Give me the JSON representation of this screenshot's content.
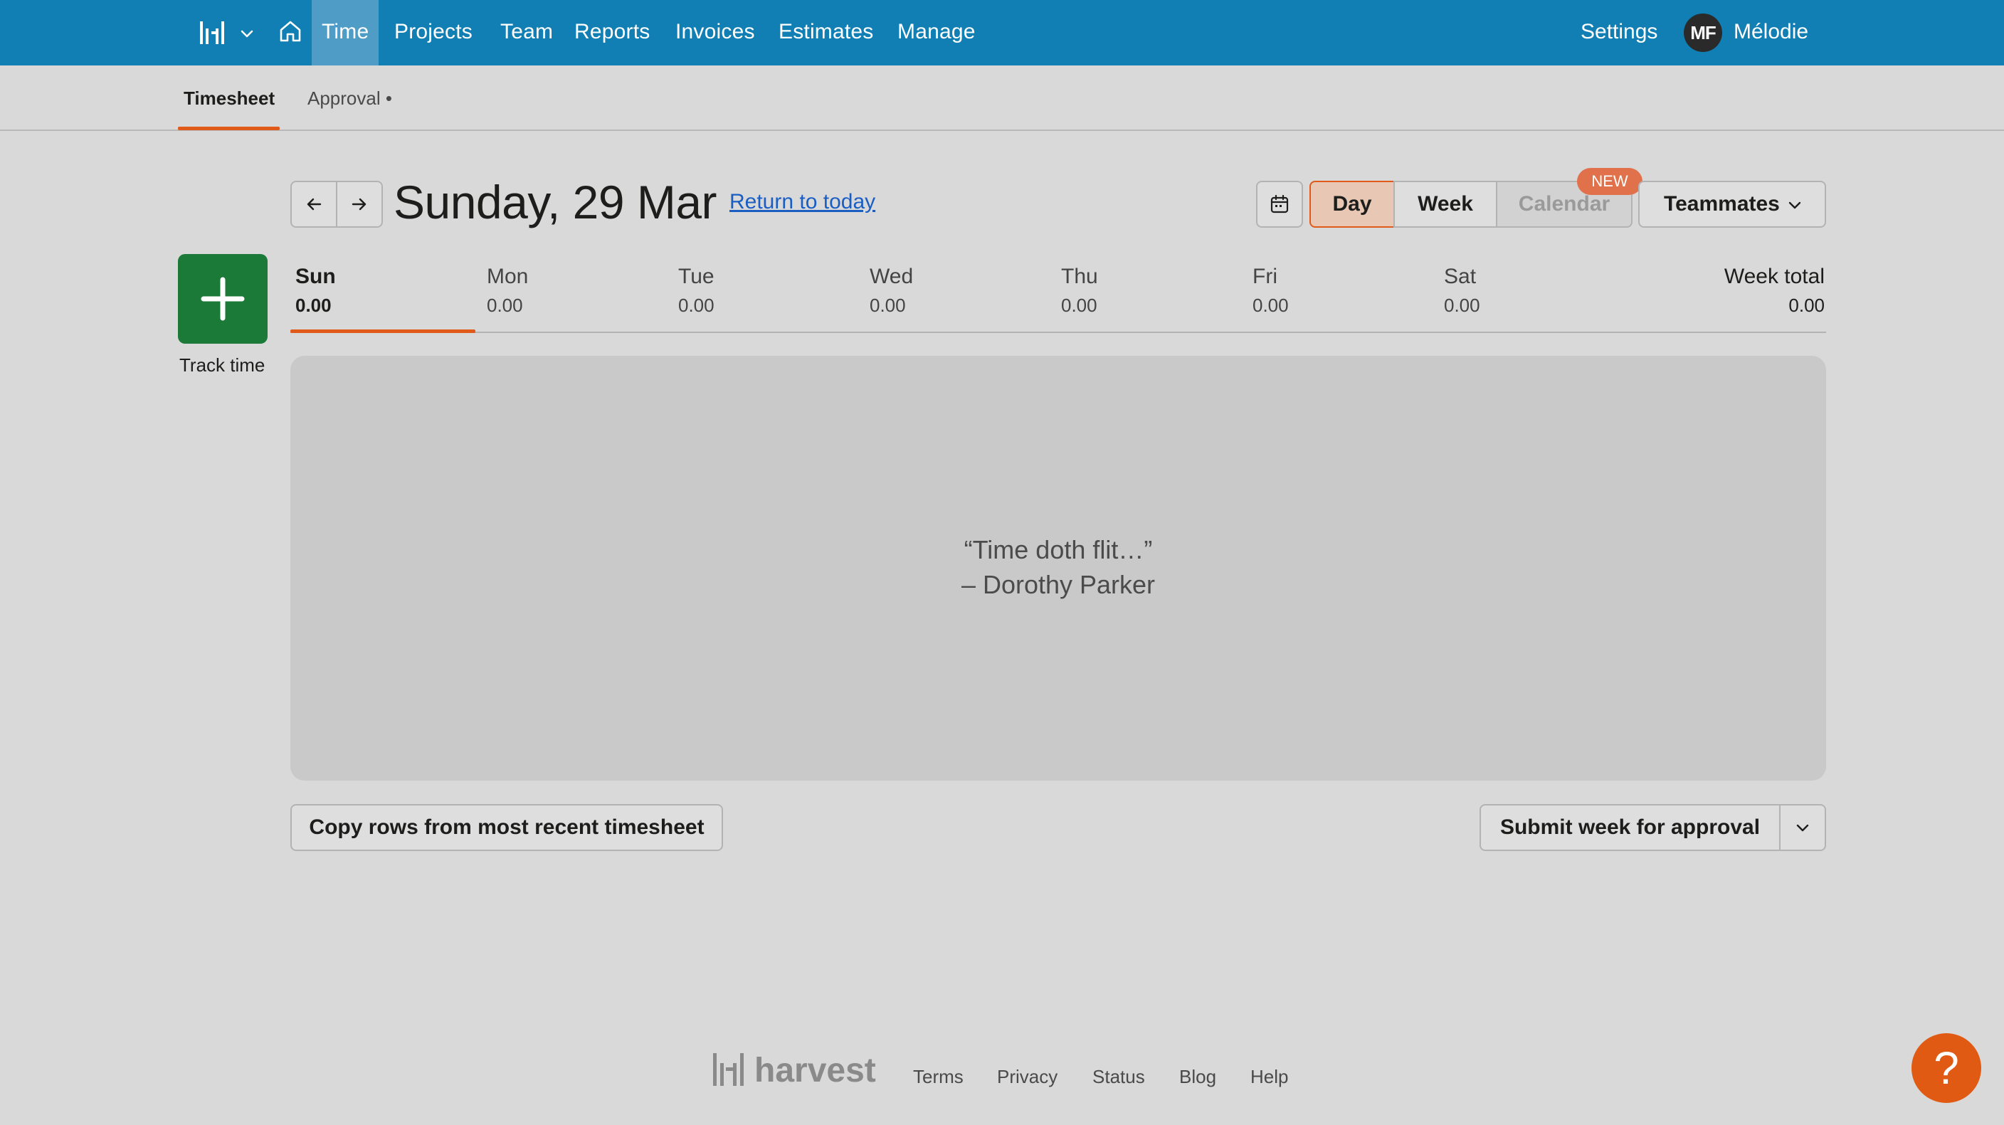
{
  "nav": {
    "logo_icon": "harvest-logo-icon",
    "items": [
      {
        "label": "Time",
        "active": true
      },
      {
        "label": "Projects"
      },
      {
        "label": "Team"
      },
      {
        "label": "Reports"
      },
      {
        "label": "Invoices"
      },
      {
        "label": "Estimates"
      },
      {
        "label": "Manage"
      }
    ],
    "settings_label": "Settings",
    "avatar_initials": "MF",
    "user_name": "Mélodie"
  },
  "subnav": {
    "tabs": [
      {
        "label": "Timesheet",
        "active": true
      },
      {
        "label": "Approval •"
      }
    ]
  },
  "header": {
    "date_title": "Sunday, 29 Mar",
    "return_link": "Return to today",
    "views": {
      "day": "Day",
      "week": "Week",
      "calendar": "Calendar"
    },
    "new_badge": "NEW",
    "teammates_label": "Teammates"
  },
  "track": {
    "label": "Track time"
  },
  "days": [
    {
      "name": "Sun",
      "value": "0.00",
      "active": true
    },
    {
      "name": "Mon",
      "value": "0.00"
    },
    {
      "name": "Tue",
      "value": "0.00"
    },
    {
      "name": "Wed",
      "value": "0.00"
    },
    {
      "name": "Thu",
      "value": "0.00"
    },
    {
      "name": "Fri",
      "value": "0.00"
    },
    {
      "name": "Sat",
      "value": "0.00"
    }
  ],
  "week_total": {
    "label": "Week total",
    "value": "0.00"
  },
  "empty_state": {
    "quote_line1": "“Time doth flit…”",
    "quote_line2": "– Dorothy Parker"
  },
  "actions": {
    "copy_rows": "Copy rows from most recent timesheet",
    "submit_week": "Submit week for approval"
  },
  "footer": {
    "brand": "harvest",
    "links": [
      "Terms",
      "Privacy",
      "Status",
      "Blog",
      "Help"
    ]
  },
  "help_fab": "?",
  "colors": {
    "nav_bg": "#117fb3",
    "nav_active": "#4f9cc6",
    "accent_orange": "#e05a1a",
    "track_green": "#1b7a37",
    "link_blue": "#1a5ec4"
  }
}
